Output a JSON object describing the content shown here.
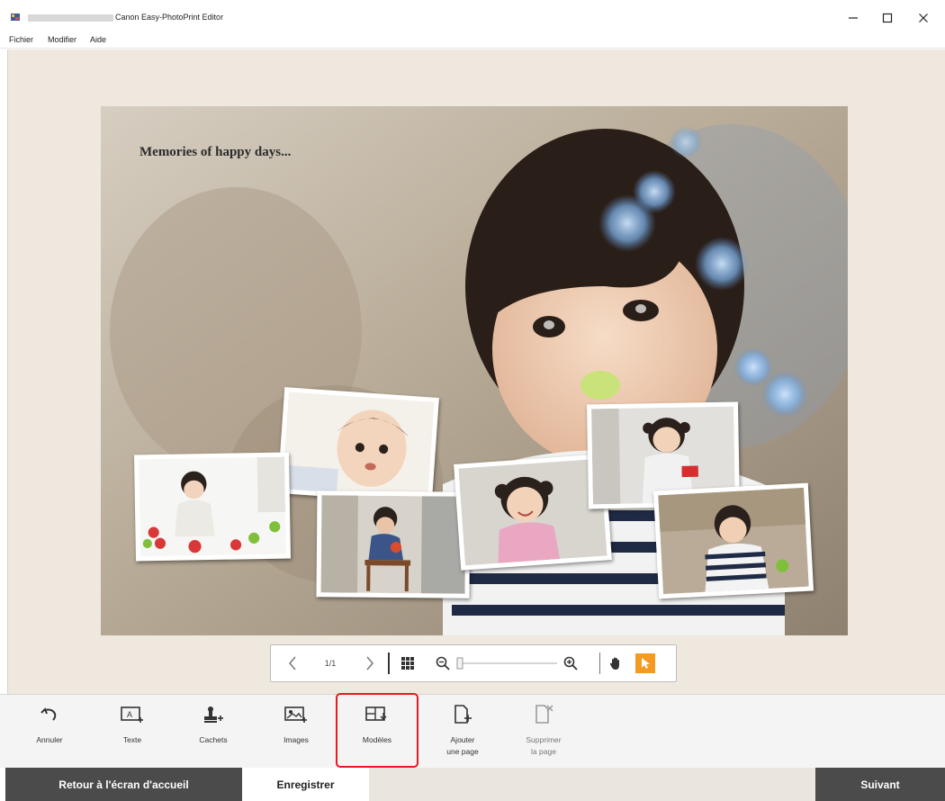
{
  "window": {
    "title": "Canon Easy-PhotoPrint Editor",
    "controls": [
      "minimize-icon",
      "maximize-icon",
      "close-icon"
    ]
  },
  "menu": {
    "items": [
      "Fichier",
      "Modifier",
      "Aide"
    ]
  },
  "canvas": {
    "text": "Memories of happy days..."
  },
  "pager": {
    "page_indicator": "1/1",
    "icons": [
      "chevron-left-icon",
      "chevron-right-icon",
      "grid-view-icon",
      "zoom-out-icon",
      "zoom-slider",
      "zoom-in-icon",
      "hand-tool-icon",
      "pointer-tool-icon"
    ],
    "zoom_level": 0.0,
    "active_tool": "pointer",
    "accent_color": "#f39a21"
  },
  "toolbar": {
    "items": [
      {
        "label": "Annuler",
        "icon": "undo-icon"
      },
      {
        "label": "Texte",
        "icon": "text-box-icon"
      },
      {
        "label": "Cachets",
        "icon": "stamp-icon"
      },
      {
        "label": "Images",
        "icon": "image-add-icon"
      },
      {
        "label": "Modèles",
        "icon": "layout-template-icon"
      },
      {
        "label": "Ajouter\nune page",
        "icon": "add-page-icon"
      },
      {
        "label": "Supprimer\nla page",
        "icon": "delete-page-icon"
      }
    ],
    "highlighted": "Modèles",
    "highlight_color": "#e8191f"
  },
  "bottom": {
    "home_label": "Retour à l'écran d'accueil",
    "save_label": "Enregistrer",
    "next_label": "Suivant"
  }
}
